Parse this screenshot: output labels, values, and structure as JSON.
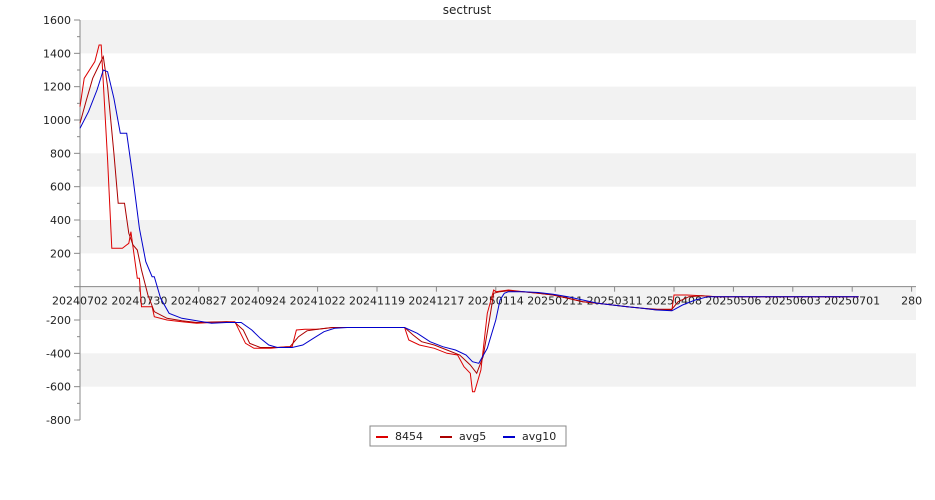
{
  "chart_data": {
    "type": "line",
    "title": "sectrust",
    "xlabel": "",
    "ylabel": "",
    "ylim": [
      -800,
      1600
    ],
    "y_ticks": [
      -800,
      -600,
      -400,
      -200,
      200,
      400,
      600,
      800,
      1000,
      1200,
      1400,
      1600
    ],
    "x_ticks": [
      "20240702",
      "20240730",
      "20240827",
      "20240924",
      "20241022",
      "20241119",
      "20241217",
      "20250114",
      "20250211",
      "20250311",
      "20250408",
      "20250506",
      "20250603",
      "20250701",
      "280"
    ],
    "grid": "horizontal bands",
    "legend_position": "bottom-center",
    "colors": {
      "8454": "#dd0000",
      "avg5": "#aa0000",
      "avg10": "#0000cc",
      "band": "#f2f2f2",
      "axis": "#888888"
    },
    "series": [
      {
        "name": "8454",
        "points": [
          [
            "20240702",
            1080
          ],
          [
            "20240704",
            1250
          ],
          [
            "20240709",
            1350
          ],
          [
            "20240711",
            1450
          ],
          [
            "20240712",
            1450
          ],
          [
            "20240715",
            760
          ],
          [
            "20240717",
            230
          ],
          [
            "20240722",
            230
          ],
          [
            "20240725",
            260
          ],
          [
            "20240726",
            330
          ],
          [
            "20240729",
            50
          ],
          [
            "20240730",
            50
          ],
          [
            "20240731",
            -120
          ],
          [
            "20240805",
            -120
          ],
          [
            "20240806",
            -180
          ],
          [
            "20240812",
            -200
          ],
          [
            "20240819",
            -210
          ],
          [
            "20240826",
            -220
          ],
          [
            "20240902",
            -215
          ],
          [
            "20240909",
            -210
          ],
          [
            "20240913",
            -210
          ],
          [
            "20240918",
            -340
          ],
          [
            "20240922",
            -370
          ],
          [
            "20240930",
            -370
          ],
          [
            "20241007",
            -360
          ],
          [
            "20241010",
            -360
          ],
          [
            "20241012",
            -260
          ],
          [
            "20241016",
            -255
          ],
          [
            "20241022",
            -255
          ],
          [
            "20241029",
            -245
          ],
          [
            "20241105",
            -245
          ],
          [
            "20241112",
            -245
          ],
          [
            "20241119",
            -245
          ],
          [
            "20241126",
            -245
          ],
          [
            "20241202",
            -245
          ],
          [
            "20241204",
            -320
          ],
          [
            "20241209",
            -350
          ],
          [
            "20241216",
            -370
          ],
          [
            "20241222",
            -400
          ],
          [
            "20241227",
            -410
          ],
          [
            "20241230",
            -480
          ],
          [
            "20250102",
            -520
          ],
          [
            "20250103",
            -630
          ],
          [
            "20250104",
            -630
          ],
          [
            "20250107",
            -500
          ],
          [
            "20250110",
            -160
          ],
          [
            "20250113",
            -20
          ],
          [
            "20250114",
            -30
          ],
          [
            "20250120",
            -20
          ],
          [
            "20250127",
            -30
          ],
          [
            "20250203",
            -40
          ],
          [
            "20250210",
            -50
          ],
          [
            "20250217",
            -70
          ],
          [
            "20250224",
            -90
          ],
          [
            "20250303",
            -100
          ],
          [
            "20250310",
            -110
          ],
          [
            "20250317",
            -120
          ],
          [
            "20250324",
            -130
          ],
          [
            "20250331",
            -140
          ],
          [
            "20250407",
            -140
          ],
          [
            "20250408",
            -50
          ],
          [
            "20250414",
            -50
          ],
          [
            "20250421",
            -55
          ],
          [
            "20250428",
            -60
          ],
          [
            "20250505",
            -60
          ],
          [
            "20250512",
            -60
          ],
          [
            "20250519",
            -60
          ],
          [
            "20250526",
            -60
          ],
          [
            "20250602",
            -60
          ],
          [
            "20250609",
            -60
          ],
          [
            "20250616",
            -60
          ],
          [
            "20250623",
            -60
          ],
          [
            "20250630",
            -60
          ],
          [
            "20250704",
            -60
          ]
        ]
      },
      {
        "name": "avg5",
        "points": [
          [
            "20240702",
            980
          ],
          [
            "20240705",
            1120
          ],
          [
            "20240708",
            1250
          ],
          [
            "20240711",
            1330
          ],
          [
            "20240713",
            1380
          ],
          [
            "20240715",
            1200
          ],
          [
            "20240718",
            800
          ],
          [
            "20240720",
            500
          ],
          [
            "20240723",
            500
          ],
          [
            "20240725",
            320
          ],
          [
            "20240727",
            250
          ],
          [
            "20240729",
            220
          ],
          [
            "20240731",
            100
          ],
          [
            "20240803",
            -50
          ],
          [
            "20240806",
            -150
          ],
          [
            "20240812",
            -190
          ],
          [
            "20240819",
            -205
          ],
          [
            "20240826",
            -215
          ],
          [
            "20240902",
            -212
          ],
          [
            "20240909",
            -210
          ],
          [
            "20240913",
            -215
          ],
          [
            "20240917",
            -260
          ],
          [
            "20240920",
            -340
          ],
          [
            "20240925",
            -365
          ],
          [
            "20241002",
            -365
          ],
          [
            "20241009",
            -360
          ],
          [
            "20241013",
            -300
          ],
          [
            "20241017",
            -265
          ],
          [
            "20241022",
            -255
          ],
          [
            "20241029",
            -245
          ],
          [
            "20241105",
            -245
          ],
          [
            "20241112",
            -245
          ],
          [
            "20241119",
            -245
          ],
          [
            "20241126",
            -245
          ],
          [
            "20241202",
            -245
          ],
          [
            "20241206",
            -290
          ],
          [
            "20241210",
            -330
          ],
          [
            "20241216",
            -350
          ],
          [
            "20241222",
            -380
          ],
          [
            "20241228",
            -410
          ],
          [
            "20250102",
            -470
          ],
          [
            "20250105",
            -520
          ],
          [
            "20250108",
            -420
          ],
          [
            "20250111",
            -200
          ],
          [
            "20250113",
            -40
          ],
          [
            "20250116",
            -30
          ],
          [
            "20250120",
            -25
          ],
          [
            "20250127",
            -30
          ],
          [
            "20250203",
            -40
          ],
          [
            "20250210",
            -50
          ],
          [
            "20250217",
            -70
          ],
          [
            "20250224",
            -90
          ],
          [
            "20250303",
            -100
          ],
          [
            "20250310",
            -110
          ],
          [
            "20250317",
            -120
          ],
          [
            "20250324",
            -130
          ],
          [
            "20250331",
            -135
          ],
          [
            "20250407",
            -135
          ],
          [
            "20250410",
            -90
          ],
          [
            "20250415",
            -60
          ],
          [
            "20250421",
            -55
          ],
          [
            "20250428",
            -60
          ],
          [
            "20250505",
            -60
          ],
          [
            "20250512",
            -60
          ],
          [
            "20250519",
            -60
          ],
          [
            "20250526",
            -60
          ],
          [
            "20250602",
            -60
          ],
          [
            "20250609",
            -60
          ],
          [
            "20250616",
            -60
          ],
          [
            "20250623",
            -60
          ],
          [
            "20250630",
            -60
          ],
          [
            "20250704",
            -60
          ]
        ]
      },
      {
        "name": "avg10",
        "points": [
          [
            "20240702",
            950
          ],
          [
            "20240706",
            1050
          ],
          [
            "20240710",
            1180
          ],
          [
            "20240713",
            1300
          ],
          [
            "20240715",
            1290
          ],
          [
            "20240718",
            1130
          ],
          [
            "20240721",
            920
          ],
          [
            "20240724",
            920
          ],
          [
            "20240727",
            650
          ],
          [
            "20240730",
            350
          ],
          [
            "20240802",
            150
          ],
          [
            "20240805",
            60
          ],
          [
            "20240806",
            60
          ],
          [
            "20240809",
            -70
          ],
          [
            "20240813",
            -160
          ],
          [
            "20240819",
            -190
          ],
          [
            "20240826",
            -205
          ],
          [
            "20240902",
            -220
          ],
          [
            "20240909",
            -215
          ],
          [
            "20240916",
            -215
          ],
          [
            "20240921",
            -260
          ],
          [
            "20240925",
            -310
          ],
          [
            "20240929",
            -350
          ],
          [
            "20241003",
            -365
          ],
          [
            "20241010",
            -365
          ],
          [
            "20241015",
            -350
          ],
          [
            "20241020",
            -310
          ],
          [
            "20241025",
            -270
          ],
          [
            "20241030",
            -250
          ],
          [
            "20241105",
            -245
          ],
          [
            "20241112",
            -245
          ],
          [
            "20241119",
            -245
          ],
          [
            "20241126",
            -245
          ],
          [
            "20241202",
            -245
          ],
          [
            "20241208",
            -280
          ],
          [
            "20241214",
            -330
          ],
          [
            "20241220",
            -360
          ],
          [
            "20241226",
            -380
          ],
          [
            "20241231",
            -410
          ],
          [
            "20250103",
            -450
          ],
          [
            "20250106",
            -460
          ],
          [
            "20250110",
            -370
          ],
          [
            "20250114",
            -200
          ],
          [
            "20250116",
            -80
          ],
          [
            "20250118",
            -40
          ],
          [
            "20250120",
            -30
          ],
          [
            "20250127",
            -30
          ],
          [
            "20250203",
            -35
          ],
          [
            "20250210",
            -45
          ],
          [
            "20250217",
            -60
          ],
          [
            "20250224",
            -80
          ],
          [
            "20250303",
            -100
          ],
          [
            "20250310",
            -110
          ],
          [
            "20250317",
            -120
          ],
          [
            "20250324",
            -130
          ],
          [
            "20250331",
            -140
          ],
          [
            "20250407",
            -145
          ],
          [
            "20250412",
            -110
          ],
          [
            "20250418",
            -80
          ],
          [
            "20250424",
            -60
          ],
          [
            "20250501",
            -60
          ],
          [
            "20250508",
            -60
          ],
          [
            "20250515",
            -60
          ],
          [
            "20250522",
            -60
          ],
          [
            "20250529",
            -60
          ],
          [
            "20250605",
            -60
          ],
          [
            "20250612",
            -60
          ],
          [
            "20250619",
            -60
          ],
          [
            "20250626",
            -60
          ],
          [
            "20250704",
            -60
          ]
        ]
      }
    ]
  }
}
